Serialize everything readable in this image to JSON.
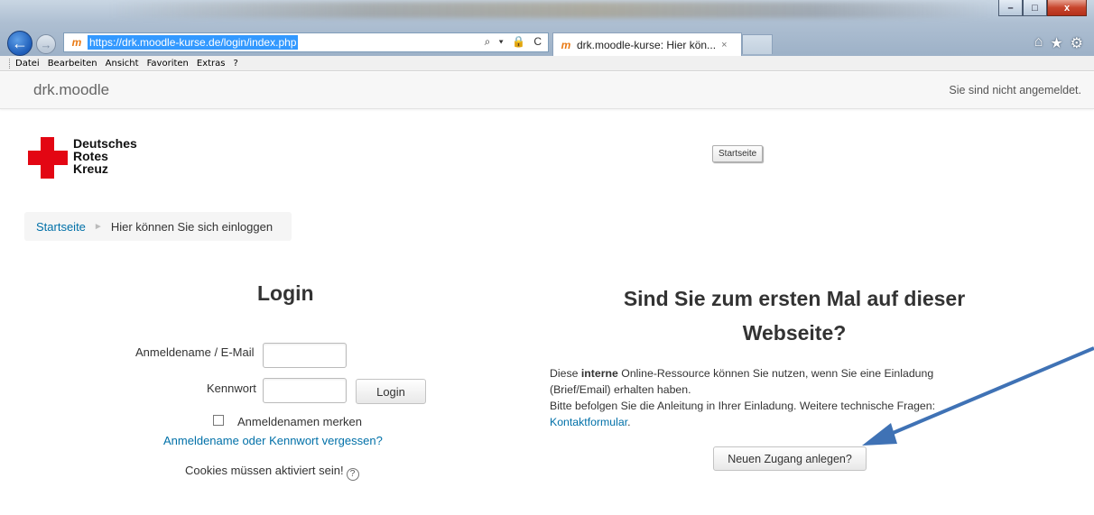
{
  "browser": {
    "url": "https://drk.moodle-kurse.de/login/index.php",
    "tab_title": "drk.moodle-kurse: Hier kön...",
    "tab_close": "×",
    "address_icons": "⌕ ▾ 🔒 C",
    "controls": {
      "minimize": "–",
      "maximize": "□",
      "close": "x"
    },
    "right_icons": [
      "home-icon",
      "star-icon",
      "gear-icon"
    ]
  },
  "menu": {
    "items": [
      "Datei",
      "Bearbeiten",
      "Ansicht",
      "Favoriten",
      "Extras",
      "?"
    ]
  },
  "header": {
    "site_name": "drk.moodle",
    "login_status": "Sie sind nicht angemeldet."
  },
  "logo": {
    "line1": "Deutsches",
    "line2": "Rotes",
    "line3": "Kreuz"
  },
  "home_button": "Startseite",
  "breadcrumb": {
    "home": "Startseite",
    "separator": "►",
    "current": "Hier können Sie sich einloggen"
  },
  "login": {
    "heading": "Login",
    "username_label": "Anmeldename / E-Mail",
    "password_label": "Kennwort",
    "submit": "Login",
    "remember_label": "Anmeldenamen merken",
    "forgot_link": "Anmeldename oder Kennwort vergessen?",
    "cookies_note": "Cookies müssen aktiviert sein!",
    "help_symbol": "?"
  },
  "signup": {
    "heading_line1": "Sind Sie zum ersten Mal auf dieser",
    "heading_line2": "Webseite?",
    "p1_pre": "Diese ",
    "p1_bold": "interne",
    "p1_post": " Online-Ressource können Sie nutzen, wenn Sie eine Einladung (Brief/Email) erhalten haben.",
    "p2": "Bitte befolgen Sie die Anleitung in Ihrer Einladung. Weitere technische Fragen: ",
    "contact_link": "Kontaktformular",
    "p2_end": ".",
    "button": "Neuen Zugang anlegen?"
  },
  "colors": {
    "link": "#0070a8",
    "drk_red": "#e30613",
    "annotation_arrow": "#3f72b5"
  }
}
